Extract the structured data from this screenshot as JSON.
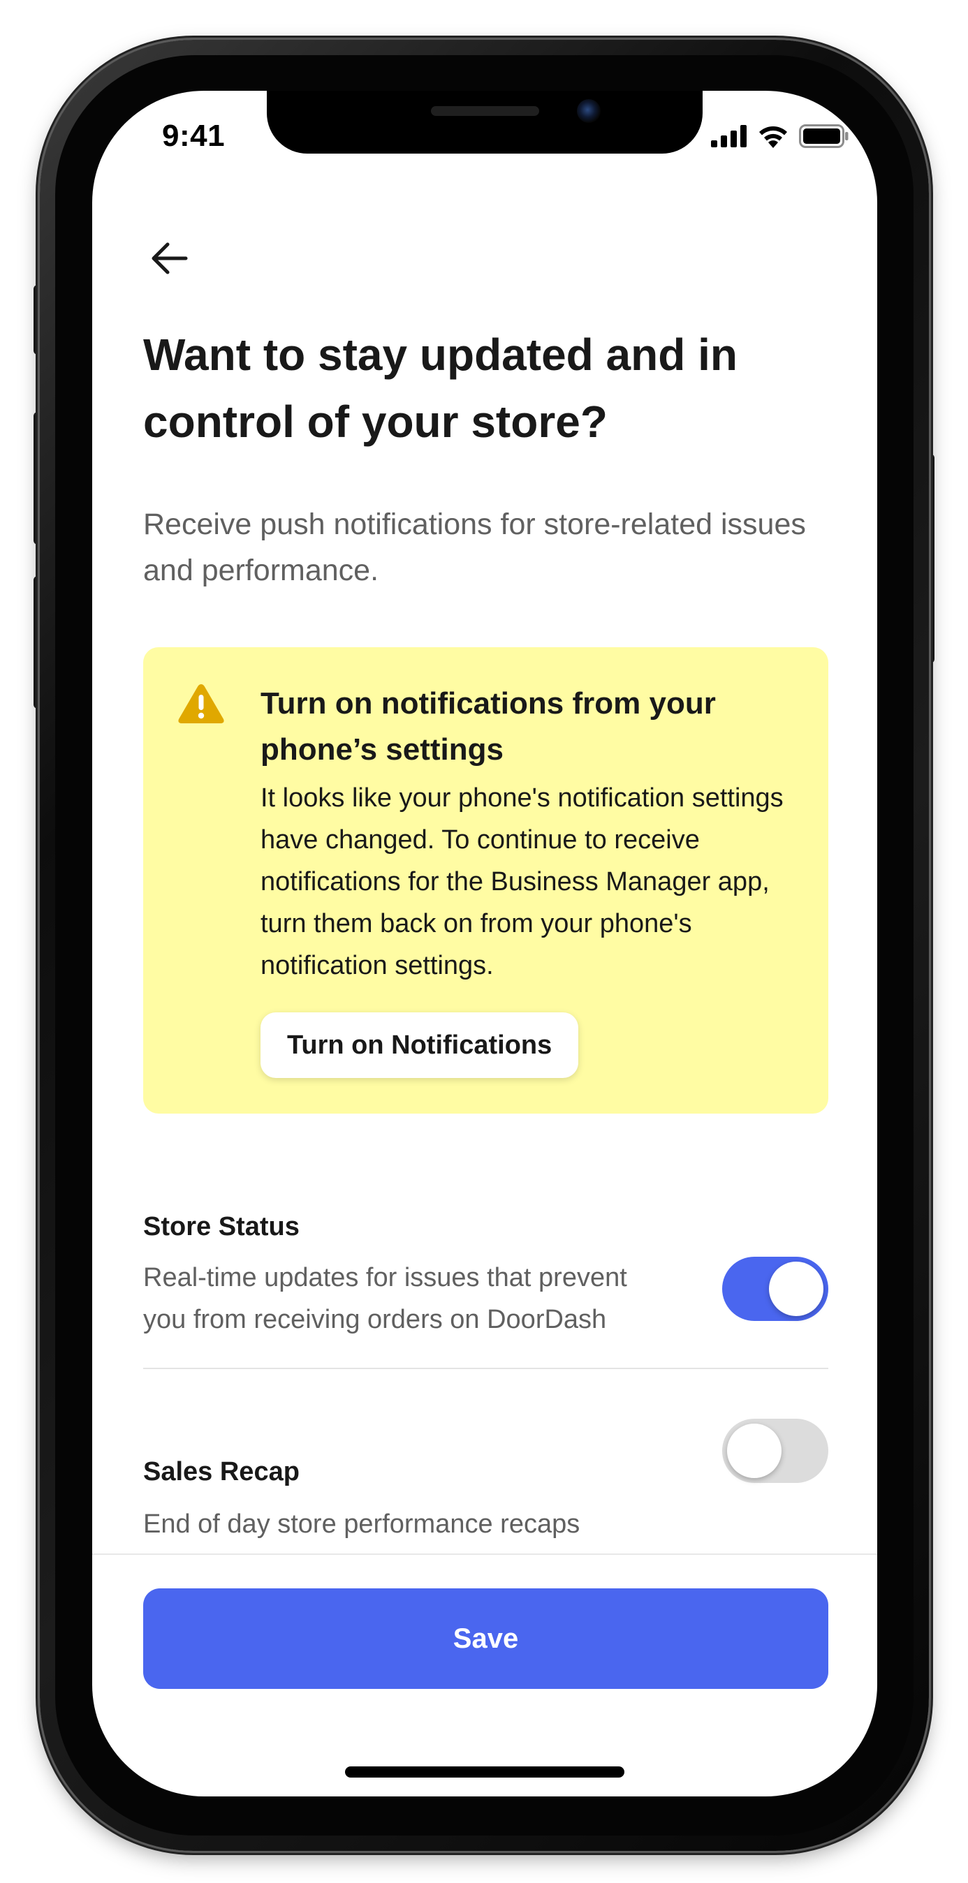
{
  "status_bar": {
    "time": "9:41",
    "icons": [
      "cellular-signal-icon",
      "wifi-icon",
      "battery-icon"
    ]
  },
  "header": {
    "back_icon": "arrow-left-icon",
    "title": "Want to stay updated and in control of your store?",
    "subtitle": "Receive push notifications for store-related issues and performance."
  },
  "banner": {
    "icon": "warning-triangle-icon",
    "title": "Turn on notifications from your phone’s settings",
    "body": "It looks like your phone's notification settings have changed. To continue to receive notifications for the Business Manager app, turn them back on from your phone's notification settings.",
    "button_label": "Turn on Notifications",
    "background": "#fffca3"
  },
  "settings": [
    {
      "title": "Store Status",
      "description": "Real-time updates for issues that prevent you from receiving orders on DoorDash",
      "enabled": true
    },
    {
      "title": "Sales Recap",
      "description": "End of day store performance recaps",
      "enabled": false
    }
  ],
  "footer": {
    "save_label": "Save"
  },
  "colors": {
    "accent": "#4a66ef",
    "warning_icon": "#e0a800",
    "toggle_off": "#dcdcdc",
    "text_primary": "#191919",
    "text_secondary": "#606060"
  }
}
